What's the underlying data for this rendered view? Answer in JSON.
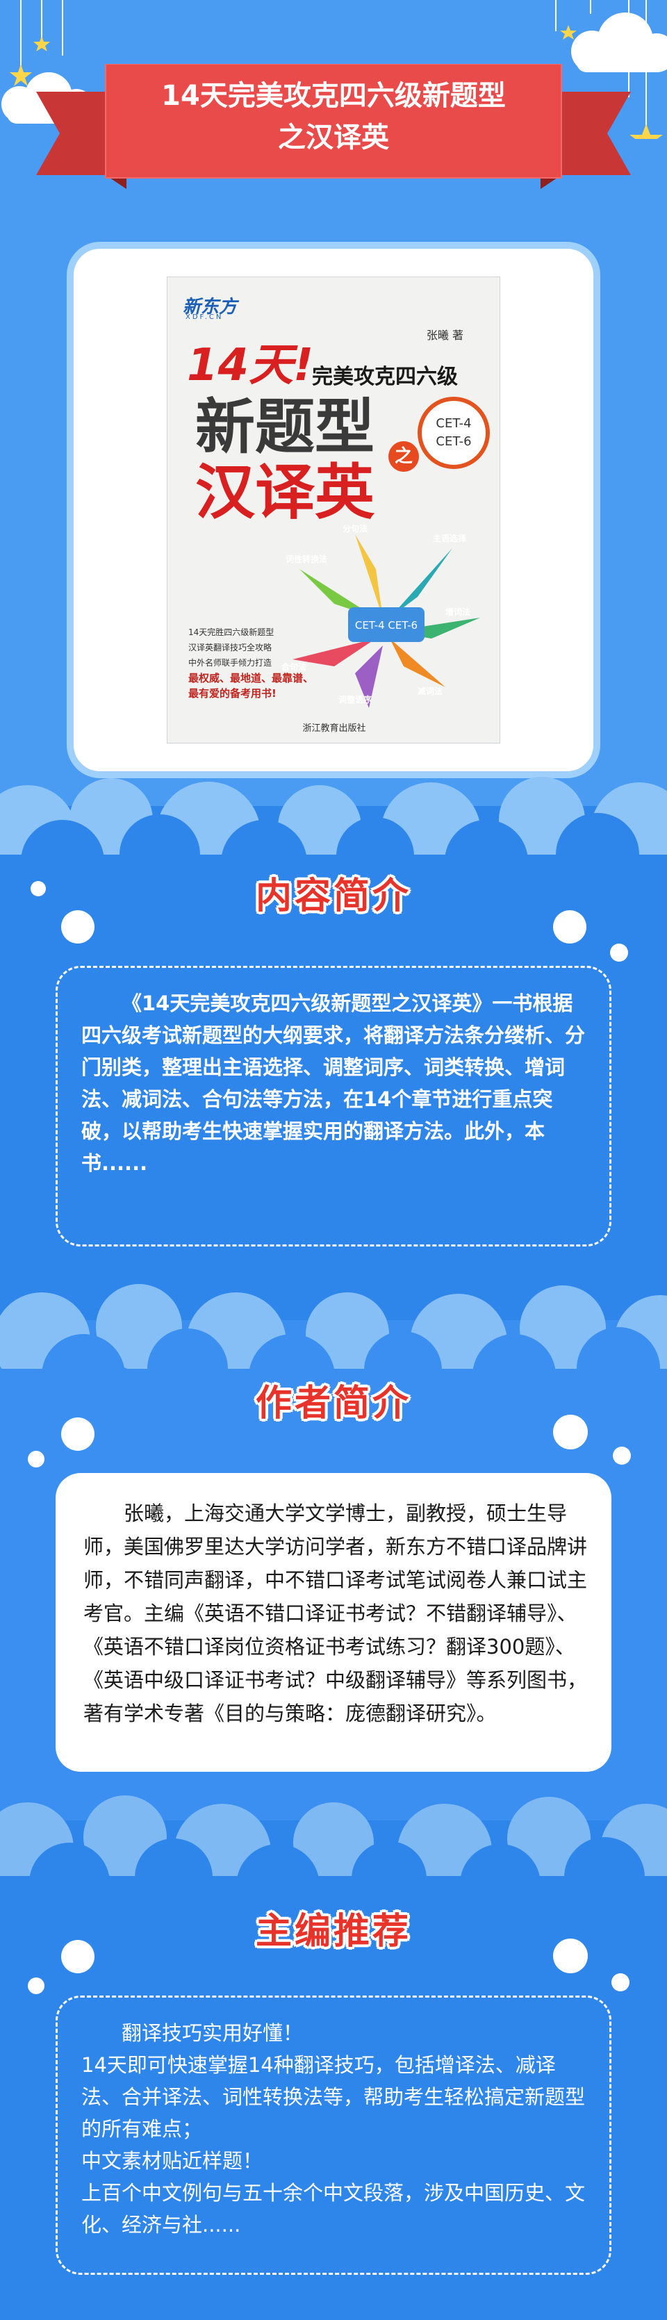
{
  "banner": {
    "title_line1": "14天完美攻克四六级新题型",
    "title_line2": "之汉译英"
  },
  "book_cover": {
    "publisher_logo": "新东方",
    "publisher_logo_sub": "XDF.CN",
    "author": "张曦 著",
    "title_14": "14天!",
    "title_sub": "完美攻克四六级",
    "title_big1": "新题型",
    "title_big2": "汉译英",
    "title_zhi": "之",
    "cet_badge_1": "CET-4",
    "cet_badge_2": "CET-6",
    "blurb_1": "14天完胜四六级新题型",
    "blurb_2": "汉译英翻译技巧全攻略",
    "blurb_3": "中外名师联手倾力打造",
    "blurb_red_1": "最权威、最地道、最靠谱、",
    "blurb_red_2": "最有爱的备考用书!",
    "publisher_name": "浙江教育出版社",
    "diagram_center": "CET-4 CET-6",
    "diagram_labels": [
      "主语选择",
      "词性转换法",
      "增词法",
      "减词法",
      "调整语序",
      "合句法",
      "分句法"
    ]
  },
  "section_intro": {
    "heading": "内容简介",
    "text": "《14天完美攻克四六级新题型之汉译英》一书根据四六级考试新题型的大纲要求，将翻译方法条分缕析、分门别类，整理出主语选择、调整词序、词类转换、增词法、减词法、合句法等方法，在14个章节进行重点突破，以帮助考生快速掌握实用的翻译方法。此外，本书......"
  },
  "section_author": {
    "heading": "作者简介",
    "text": "张曦，上海交通大学文学博士，副教授，硕士生导师，美国佛罗里达大学访问学者，新东方不错口译品牌讲师，不错同声翻译，中不错口译考试笔试阅卷人兼口试主考官。主编《英语不错口译证书考试？不错翻译辅导》、《英语不错口译岗位资格证书考试练习？翻译300题》、《英语中级口译证书考试？中级翻译辅导》等系列图书，著有学术专著《目的与策略：庞德翻译研究》。"
  },
  "section_recommend": {
    "heading": "主编推荐",
    "line1": "翻译技巧实用好懂！",
    "line2": "14天即可快速掌握14种翻译技巧，包括增译法、减译法、合并译法、词性转换法等，帮助考生轻松搞定新题型的所有难点；",
    "line3": "中文素材贴近样题！",
    "line4": "上百个中文例句与五十余个中文段落，涉及中国历史、文化、经济与社......"
  },
  "colors": {
    "background_blue": "#3d92ee",
    "ribbon_red": "#e94b4b",
    "heading_red": "#e8332a",
    "frame_light_blue": "#9fd0fb"
  }
}
